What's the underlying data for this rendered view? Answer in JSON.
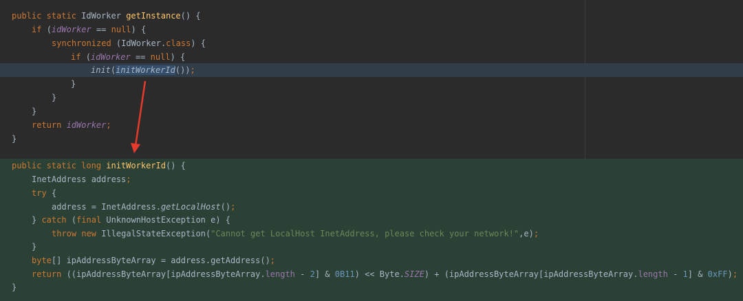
{
  "code": {
    "method1": {
      "l1": {
        "t1": "public static ",
        "t2": "IdWorker ",
        "t3": "getInstance",
        "t4": "() {"
      },
      "l2": {
        "t1": "if ",
        "t2": "(",
        "t3": "idWorker",
        "t4": " == ",
        "t5": "null",
        "t6": ") {"
      },
      "l3": {
        "t1": "synchronized ",
        "t2": "(IdWorker.",
        "t3": "class",
        "t4": ") {"
      },
      "l4": {
        "t1": "if ",
        "t2": "(",
        "t3": "idWorker",
        "t4": " == ",
        "t5": "null",
        "t6": ") {"
      },
      "l5": {
        "t1": "init",
        "t2": "(",
        "t3": "initWorkerId",
        "t4": "())",
        "t5": ";"
      },
      "l6": "}",
      "l7": "}",
      "l8": "}",
      "l9": {
        "t1": "return ",
        "t2": "idWorker",
        "t3": ";"
      },
      "l10": "}"
    },
    "method2": {
      "l1": {
        "t1": "public static long ",
        "t2": "initWorkerId",
        "t3": "() {"
      },
      "l2": {
        "t1": "InetAddress address",
        "t2": ";"
      },
      "l3": {
        "t1": "try ",
        "t2": "{"
      },
      "l4": {
        "t1": "address = InetAddress.",
        "t2": "getLocalHost",
        "t3": "()",
        "t4": ";"
      },
      "l5": {
        "t1": "} ",
        "t2": "catch ",
        "t3": "(",
        "t4": "final ",
        "t5": "UnknownHostException e) {"
      },
      "l6": {
        "t1": "throw new ",
        "t2": "IllegalStateException(",
        "t3": "\"Cannot get LocalHost InetAddress, please check your network!\"",
        "t4": ",e)",
        "t5": ";"
      },
      "l7": "}",
      "l8": {
        "t1": "byte",
        "t2": "[] ipAddressByteArray = address.getAddress()",
        "t3": ";"
      },
      "l9": {
        "t1": "return ",
        "t2": "((ipAddressByteArray[ipAddressByteArray.",
        "t3": "length",
        "t4": " - ",
        "t5": "2",
        "t6": "] & ",
        "t7": "0B11",
        "t8": ") << Byte.",
        "t9": "SIZE",
        "t10": ") + (ipAddressByteArray[ipAddressByteArray.",
        "t11": "length",
        "t12": " - ",
        "t13": "1",
        "t14": "] & ",
        "t15": "0xFF",
        "t16": ")",
        "t17": ";"
      },
      "l10": "}"
    }
  },
  "colors": {
    "background": "#2b2b2b",
    "keyword": "#cc7832",
    "method": "#ffc66d",
    "field": "#9876aa",
    "string": "#6a8759",
    "number": "#6897bb",
    "text": "#a9b7c6",
    "current_line": "#323d4a",
    "green_block": "#2c4136",
    "annotation_arrow": "#e53a2c"
  },
  "annotation": {
    "type": "arrow",
    "icon": "red-arrow-icon"
  }
}
